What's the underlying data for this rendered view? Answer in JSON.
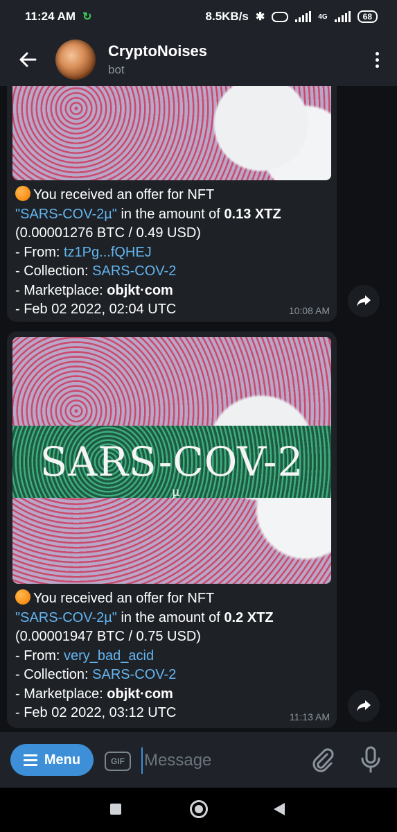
{
  "status_bar": {
    "time": "11:24 AM",
    "net_speed": "8.5KB/s",
    "network": "4G",
    "battery": "68"
  },
  "chat": {
    "title": "CryptoNoises",
    "subtitle": "bot"
  },
  "messages": [
    {
      "intro": "You received an offer for NFT",
      "nft_name": "\"SARS-COV-2µ\"",
      "amount_prefix": "in the amount of",
      "amount": "0.13 XTZ",
      "conversion": "(0.00001276 BTC / 0.49 USD)",
      "from_label": "- From:",
      "from_value": "tz1Pg...fQHEJ",
      "collection_label": "- Collection:",
      "collection_value": "SARS-COV-2",
      "marketplace_label": "- Marketplace:",
      "marketplace_value": "objkt·com",
      "date": "- Feb 02 2022, 02:04 UTC",
      "time": "10:08 AM"
    },
    {
      "image_logo": "SARS-COV-2",
      "image_logo_sub": "µ",
      "intro": "You received an offer for NFT",
      "nft_name": "\"SARS-COV-2µ\"",
      "amount_prefix": "in the amount of",
      "amount": "0.2 XTZ",
      "conversion": "(0.00001947 BTC / 0.75 USD)",
      "from_label": "- From:",
      "from_value": "very_bad_acid",
      "collection_label": "- Collection:",
      "collection_value": "SARS-COV-2",
      "marketplace_label": "- Marketplace:",
      "marketplace_value": "objkt·com",
      "date": "- Feb 02 2022, 03:12 UTC",
      "time": "11:13 AM"
    }
  ],
  "input_bar": {
    "menu_label": "Menu",
    "gif_label": "GIF",
    "placeholder": "Message"
  },
  "colors": {
    "link": "#64b5ef",
    "accent": "#3d8fd8",
    "bubble": "#1e2227",
    "header": "#1f2329"
  },
  "icons": [
    "back-arrow-icon",
    "more-vert-icon",
    "share-icon",
    "attach-icon",
    "mic-icon",
    "gif-icon",
    "coin-icon"
  ]
}
